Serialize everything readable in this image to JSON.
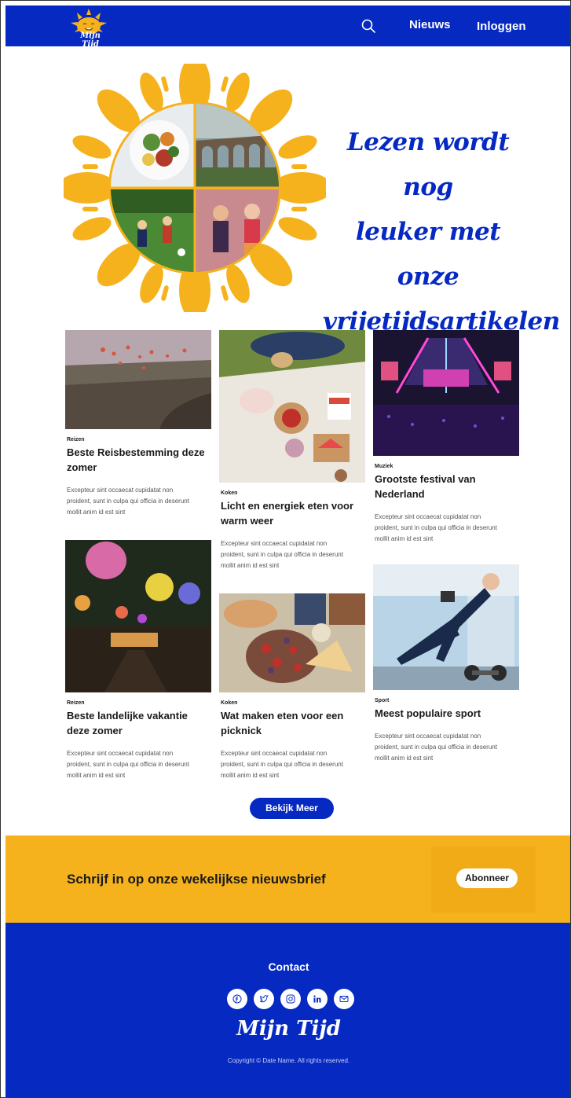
{
  "header": {
    "logo_text": "Mijn Tijd",
    "nav": [
      "Nieuws",
      "Inloggen"
    ]
  },
  "hero": {
    "title_lines": [
      "Lezen wordt nog",
      "leuker met onze",
      "vrijetijdsartikelen"
    ]
  },
  "cards": [
    {
      "category": "Reizen",
      "title": "Beste Reisbestemming deze zomer",
      "text": "Excepteur sint occaecat cupidatat non proident, sunt in culpa qui officia in deserunt mollit anim id est sint"
    },
    {
      "category": "Koken",
      "title": "Licht en energiek eten voor warm weer",
      "text": "Excepteur sint occaecat cupidatat non proident, sunt in culpa qui officia in deserunt mollit anim id est sint"
    },
    {
      "category": "Muziek",
      "title": "Grootste festival van Nederland",
      "text": "Excepteur sint occaecat cupidatat non proident, sunt in culpa qui officia in deserunt mollit anim id est sint"
    },
    {
      "category": "Reizen",
      "title": "Beste landelijke vakantie deze zomer",
      "text": "Excepteur sint occaecat cupidatat non proident, sunt in culpa qui officia in deserunt mollit anim id est sint"
    },
    {
      "category": "Koken",
      "title": "Wat maken eten voor een picknick",
      "text": "Excepteur sint occaecat cupidatat non proident, sunt in culpa qui officia in deserunt mollit anim id est sint"
    },
    {
      "category": "Sport",
      "title": "Meest populaire sport",
      "text": "Excepteur sint occaecat cupidatat non proident, sunt in culpa qui officia in deserunt mollit anim id est sint"
    }
  ],
  "more_button": "Bekijk Meer",
  "newsletter": {
    "title": "Schrijf in op onze wekelijkse nieuwsbrief",
    "button": "Abonneer"
  },
  "footer": {
    "contact": "Contact",
    "socials": [
      "facebook-icon",
      "twitter-icon",
      "instagram-icon",
      "linkedin-icon",
      "mail-icon"
    ],
    "logo_text": "Mijn Tijd",
    "copyright": "Copyright © Date Name. All rights reserved."
  },
  "colors": {
    "brand_blue": "#0629c2",
    "sun_yellow": "#f5b21d"
  }
}
